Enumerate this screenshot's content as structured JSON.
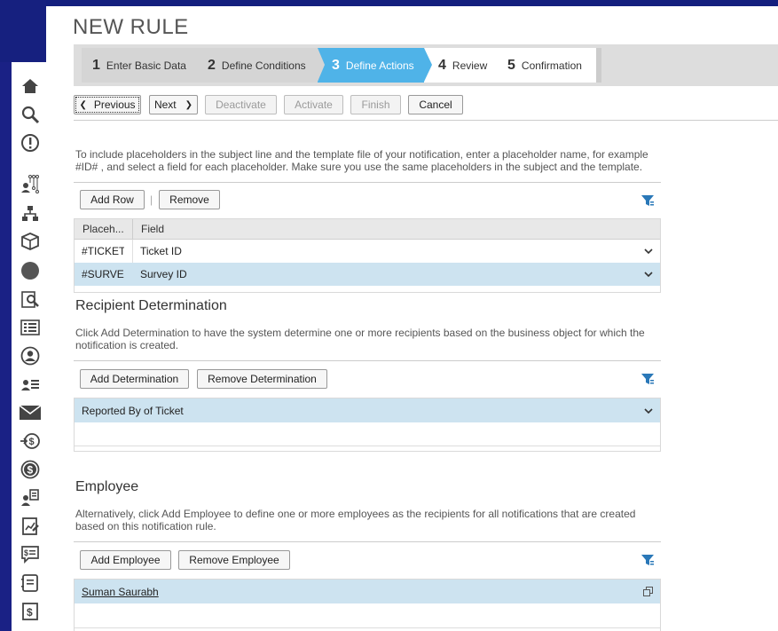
{
  "page": {
    "title": "NEW RULE"
  },
  "steps": [
    {
      "num": "1",
      "label": "Enter Basic Data"
    },
    {
      "num": "2",
      "label": "Define Conditions"
    },
    {
      "num": "3",
      "label": "Define Actions"
    },
    {
      "num": "4",
      "label": "Review"
    },
    {
      "num": "5",
      "label": "Confirmation"
    }
  ],
  "toolbar": {
    "previous": "Previous",
    "next": "Next",
    "deactivate": "Deactivate",
    "activate": "Activate",
    "finish": "Finish",
    "cancel": "Cancel"
  },
  "placeholders": {
    "description": "To include placeholders in the subject line and the template file of your notification, enter a placeholder name, for example #ID# , and select a field for each placeholder. Make sure you use the same placeholders in the subject and the template.",
    "add_row": "Add Row",
    "separator": "|",
    "remove": "Remove",
    "columns": [
      "Placeh...",
      "Field"
    ],
    "rows": [
      {
        "placeholder": "#TICKET",
        "field": "Ticket ID"
      },
      {
        "placeholder": "#SURVE",
        "field": "Survey ID"
      }
    ]
  },
  "recipient": {
    "title": "Recipient Determination",
    "description": "Click Add Determination to have the system determine one or more recipients based on the business object for which the notification is created.",
    "add": "Add Determination",
    "remove": "Remove Determination",
    "rows": [
      "Reported By of Ticket"
    ]
  },
  "employee": {
    "title": "Employee",
    "description": "Alternatively, click Add Employee to define one or more employees as the recipients for all notifications that are created based on this notification rule.",
    "add": "Add Employee",
    "remove": "Remove Employee",
    "rows": [
      "Suman Saurabh"
    ]
  },
  "colors": {
    "accent": "#4fb3e8",
    "selected_row": "#cde3f0",
    "filter_icon": "#2a78b8",
    "background": "#16207f"
  },
  "sidebar_icons": [
    "home-icon",
    "search-icon",
    "alert-icon",
    "org-people-icon",
    "hierarchy-icon",
    "box-icon",
    "circle-icon",
    "analytics-icon",
    "list-icon",
    "person-icon",
    "people-list-icon",
    "mail-icon",
    "money-in-icon",
    "dollar-icon",
    "person-doc-icon",
    "report-icon",
    "chat-dollar-icon",
    "notebook-icon",
    "dollar-doc-icon"
  ]
}
